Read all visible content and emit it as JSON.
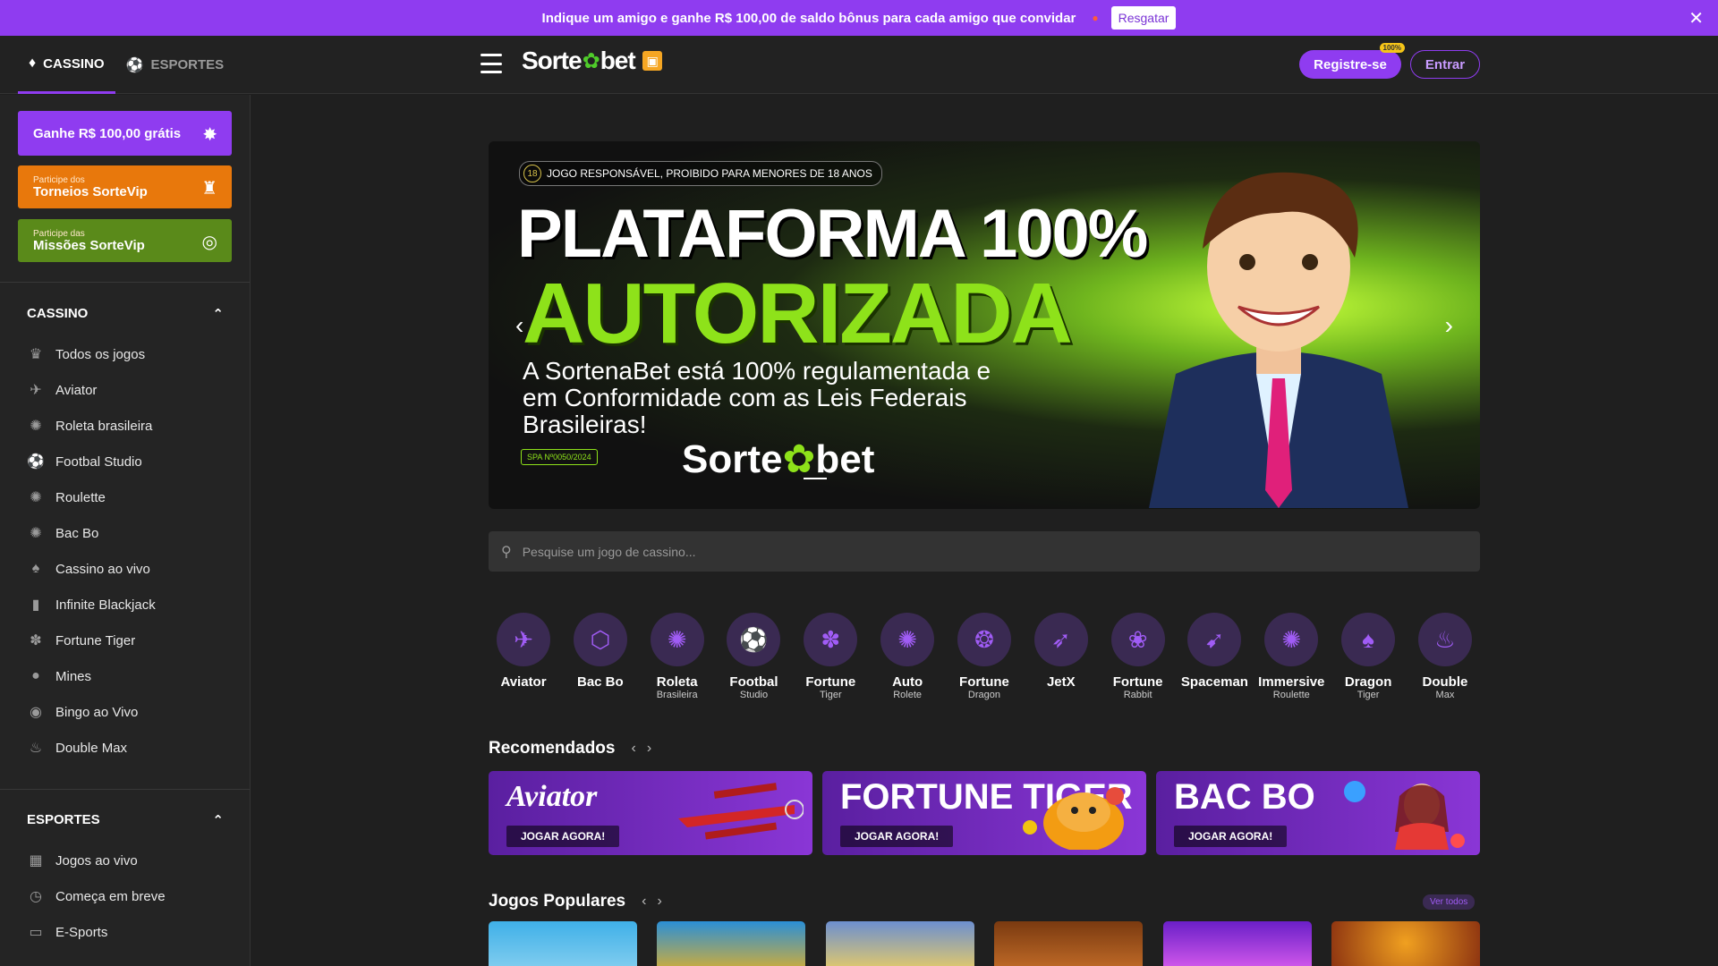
{
  "promo_bar": {
    "text": "Indique um amigo e ganhe R$ 100,00 de saldo bônus para cada amigo que convidar",
    "button": "Resgatar",
    "close_icon": "close-icon"
  },
  "header": {
    "tabs": [
      {
        "label": "CASSINO",
        "icon": "casino-chip-icon",
        "active": true
      },
      {
        "label": "ESPORTES",
        "icon": "soccer-ball-icon",
        "active": false
      }
    ],
    "logo_left": "Sorte",
    "logo_right": "bet",
    "register_label": "Registre-se",
    "register_badge": "100%",
    "login_label": "Entrar"
  },
  "sidebar": {
    "cards": [
      {
        "small": "",
        "big": "Ganhe R$ 100,00 grátis"
      },
      {
        "small": "Participe dos",
        "big": "Torneios SorteVip"
      },
      {
        "small": "Participe das",
        "big": "Missões SorteVip"
      }
    ],
    "casino_title": "CASSINO",
    "casino_items": [
      {
        "label": "Todos os jogos",
        "icon": "crown-icon"
      },
      {
        "label": "Aviator",
        "icon": "plane-icon"
      },
      {
        "label": "Roleta brasileira",
        "icon": "roulette-icon"
      },
      {
        "label": "Footbal Studio",
        "icon": "soccer-ball-icon"
      },
      {
        "label": "Roulette",
        "icon": "roulette-icon"
      },
      {
        "label": "Bac Bo",
        "icon": "roulette-icon"
      },
      {
        "label": "Cassino ao vivo",
        "icon": "cards-icon"
      },
      {
        "label": "Infinite Blackjack",
        "icon": "card-icon"
      },
      {
        "label": "Fortune Tiger",
        "icon": "paw-icon"
      },
      {
        "label": "Mines",
        "icon": "mine-icon"
      },
      {
        "label": "Bingo ao Vivo",
        "icon": "bingo-ball-icon"
      },
      {
        "label": "Double Max",
        "icon": "flame-icon"
      }
    ],
    "sports_title": "ESPORTES",
    "sports_items": [
      {
        "label": "Jogos ao vivo",
        "icon": "live-tv-icon"
      },
      {
        "label": "Começa em breve",
        "icon": "clock-icon"
      },
      {
        "label": "E-Sports",
        "icon": "gamepad-icon"
      }
    ]
  },
  "banner": {
    "age_badge": "18",
    "age_text": "JOGO RESPONSÁVEL, PROIBIDO PARA MENORES DE 18 ANOS",
    "headline1": "PLATAFORMA 100%",
    "headline2": "AUTORIZADA",
    "subtitle": "A SortenaBet está 100% regulamentada e em Conformidade com as Leis Federais Brasileiras!",
    "spa_badge": "SPA Nº0050/2024",
    "logo_left": "Sorte",
    "logo_right": "bet"
  },
  "search": {
    "placeholder": "Pesquise um jogo de cassino..."
  },
  "game_categories": [
    {
      "name": "Aviator",
      "sub": "",
      "icon": "plane-icon"
    },
    {
      "name": "Bac Bo",
      "sub": "",
      "icon": "dice-icon"
    },
    {
      "name": "Roleta",
      "sub": "Brasileira",
      "icon": "roulette-icon"
    },
    {
      "name": "Footbal",
      "sub": "Studio",
      "icon": "soccer-ball-icon"
    },
    {
      "name": "Fortune",
      "sub": "Tiger",
      "icon": "paw-icon"
    },
    {
      "name": "Auto",
      "sub": "Rolete",
      "icon": "roulette-icon"
    },
    {
      "name": "Fortune",
      "sub": "Dragon",
      "icon": "dragon-icon"
    },
    {
      "name": "JetX",
      "sub": "",
      "icon": "jet-icon"
    },
    {
      "name": "Fortune",
      "sub": "Rabbit",
      "icon": "rabbit-icon"
    },
    {
      "name": "Spaceman",
      "sub": "",
      "icon": "rocket-icon"
    },
    {
      "name": "Immersive",
      "sub": "Roulette",
      "icon": "roulette-icon"
    },
    {
      "name": "Dragon",
      "sub": "Tiger",
      "icon": "cards-icon"
    },
    {
      "name": "Double",
      "sub": "Max",
      "icon": "flame-icon"
    }
  ],
  "recommended": {
    "title": "Recomendados",
    "items": [
      {
        "title": "Aviator",
        "cta": "JOGAR AGORA!"
      },
      {
        "title": "FORTUNE TIGER",
        "cta": "JOGAR AGORA!"
      },
      {
        "title": "BAC BO",
        "cta": "JOGAR AGORA!"
      }
    ]
  },
  "popular": {
    "title": "Jogos Populares",
    "see_all": "Ver todos"
  }
}
